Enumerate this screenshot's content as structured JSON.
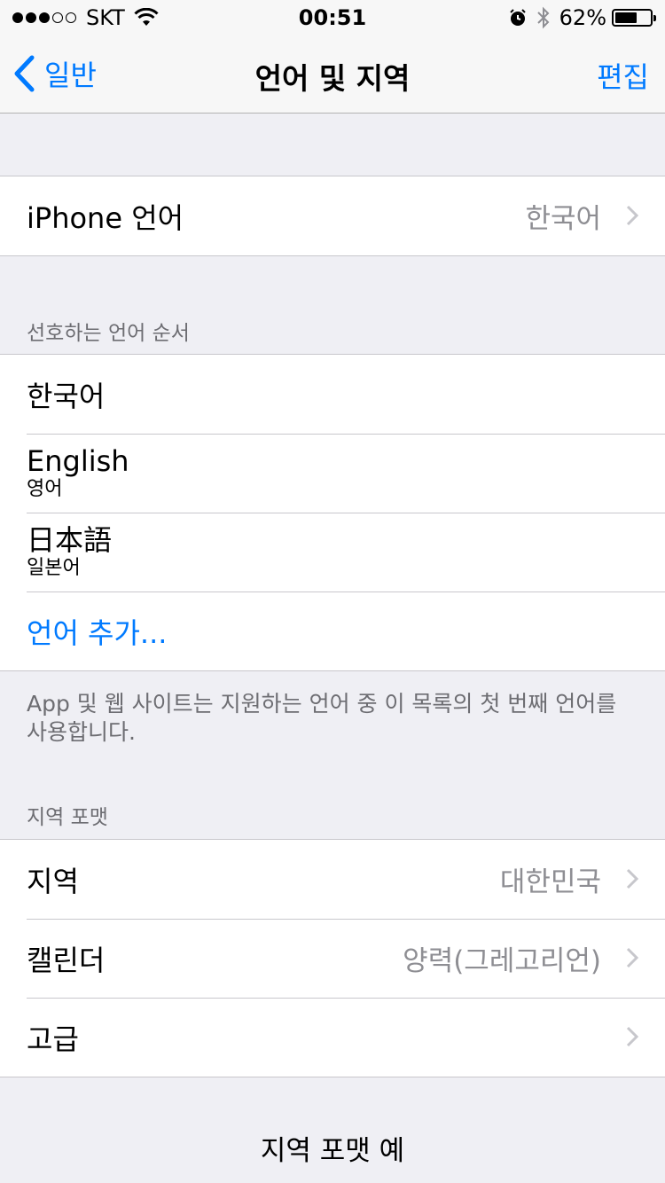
{
  "status": {
    "carrier": "SKT",
    "time": "00:51",
    "battery": "62%",
    "battery_level": 0.62
  },
  "nav": {
    "back": "일반",
    "title": "언어 및 지역",
    "edit": "편집"
  },
  "iphone_language": {
    "label": "iPhone 언어",
    "value": "한국어"
  },
  "preferred": {
    "header": "선호하는 언어 순서",
    "items": [
      {
        "label": "한국어"
      },
      {
        "label": "English",
        "sub": "영어"
      },
      {
        "label": "日本語",
        "sub": "일본어"
      }
    ],
    "add": "언어 추가...",
    "footer": "App 및 웹 사이트는 지원하는 언어 중 이 목록의 첫 번째 언어를 사용합니다."
  },
  "region_format": {
    "header": "지역 포맷",
    "items": [
      {
        "label": "지역",
        "value": "대한민국"
      },
      {
        "label": "캘린더",
        "value": "양력(그레고리언)"
      },
      {
        "label": "고급",
        "value": ""
      }
    ],
    "example_title": "지역 포맷 예"
  }
}
